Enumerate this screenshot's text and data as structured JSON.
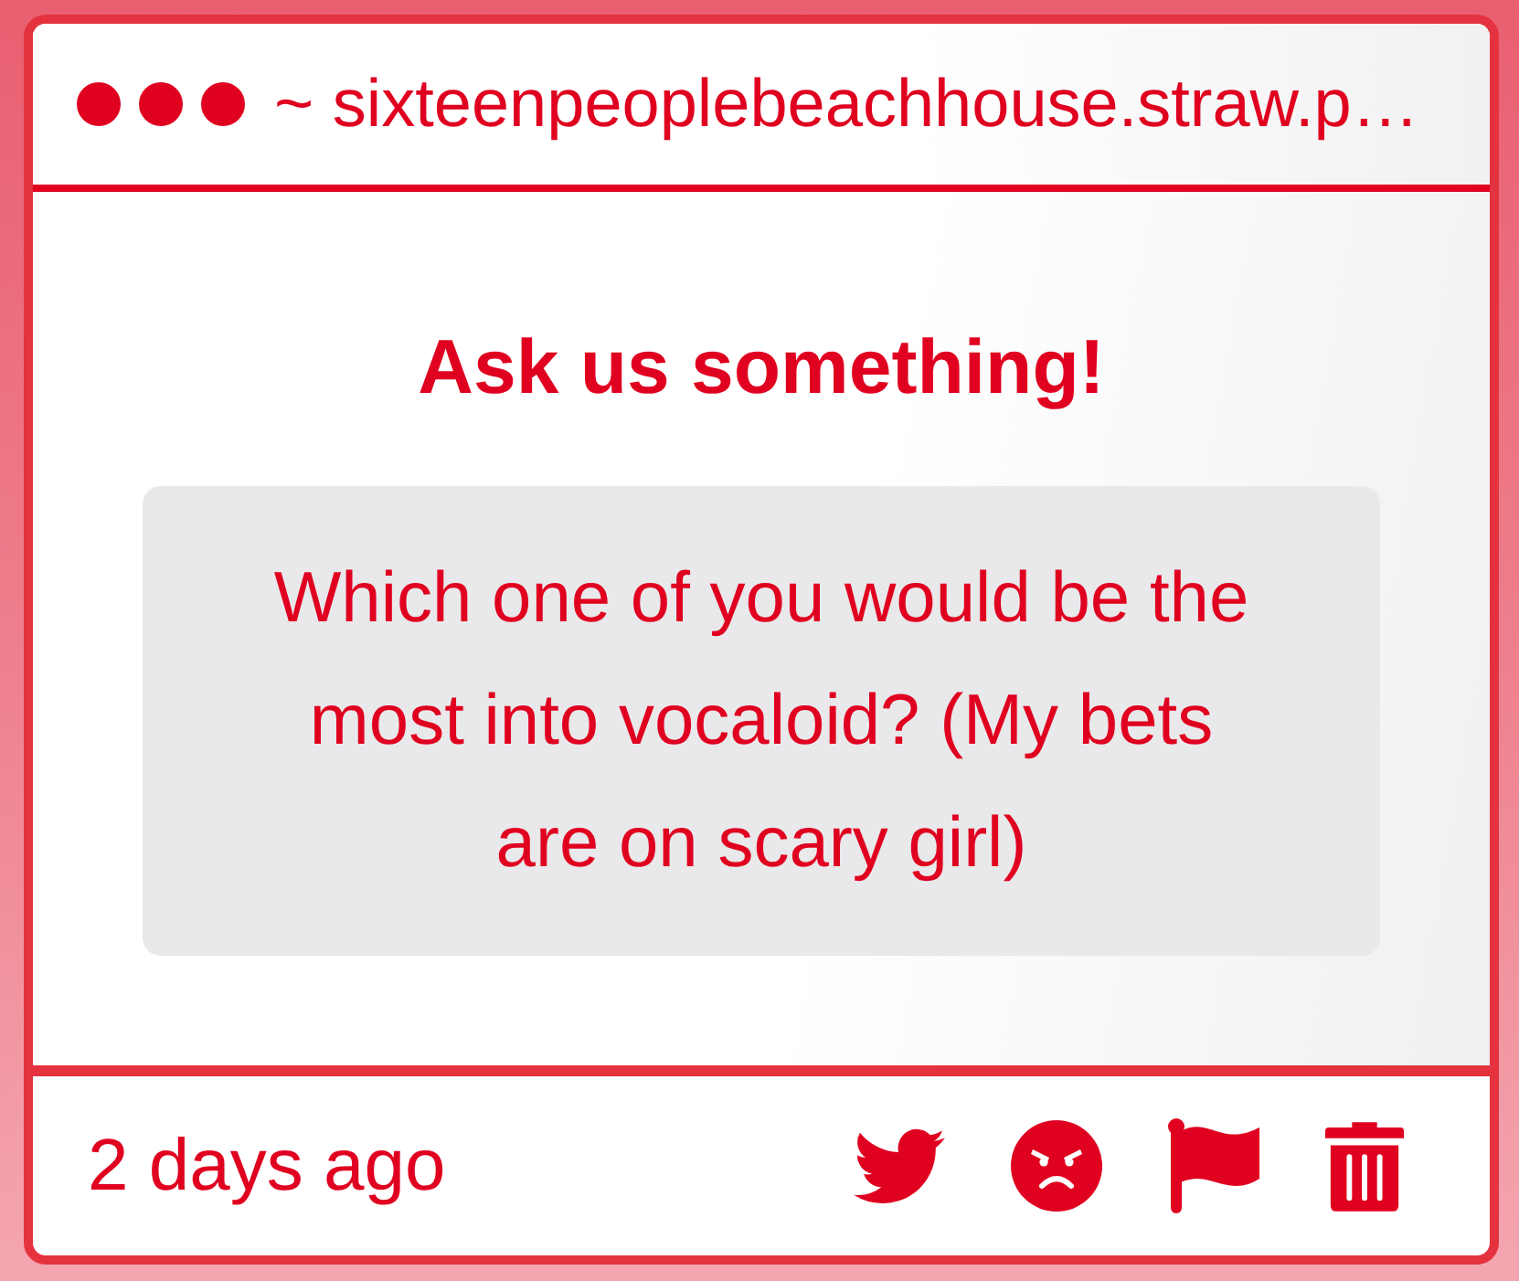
{
  "header": {
    "address": "~ sixteenpeoplebeachhouse.straw.p…"
  },
  "prompt": {
    "title": "Ask us something!"
  },
  "question": {
    "text": "Which one of you would be the most into vocaloid? (My bets are on scary girl)"
  },
  "footer": {
    "time": "2 days ago"
  }
}
